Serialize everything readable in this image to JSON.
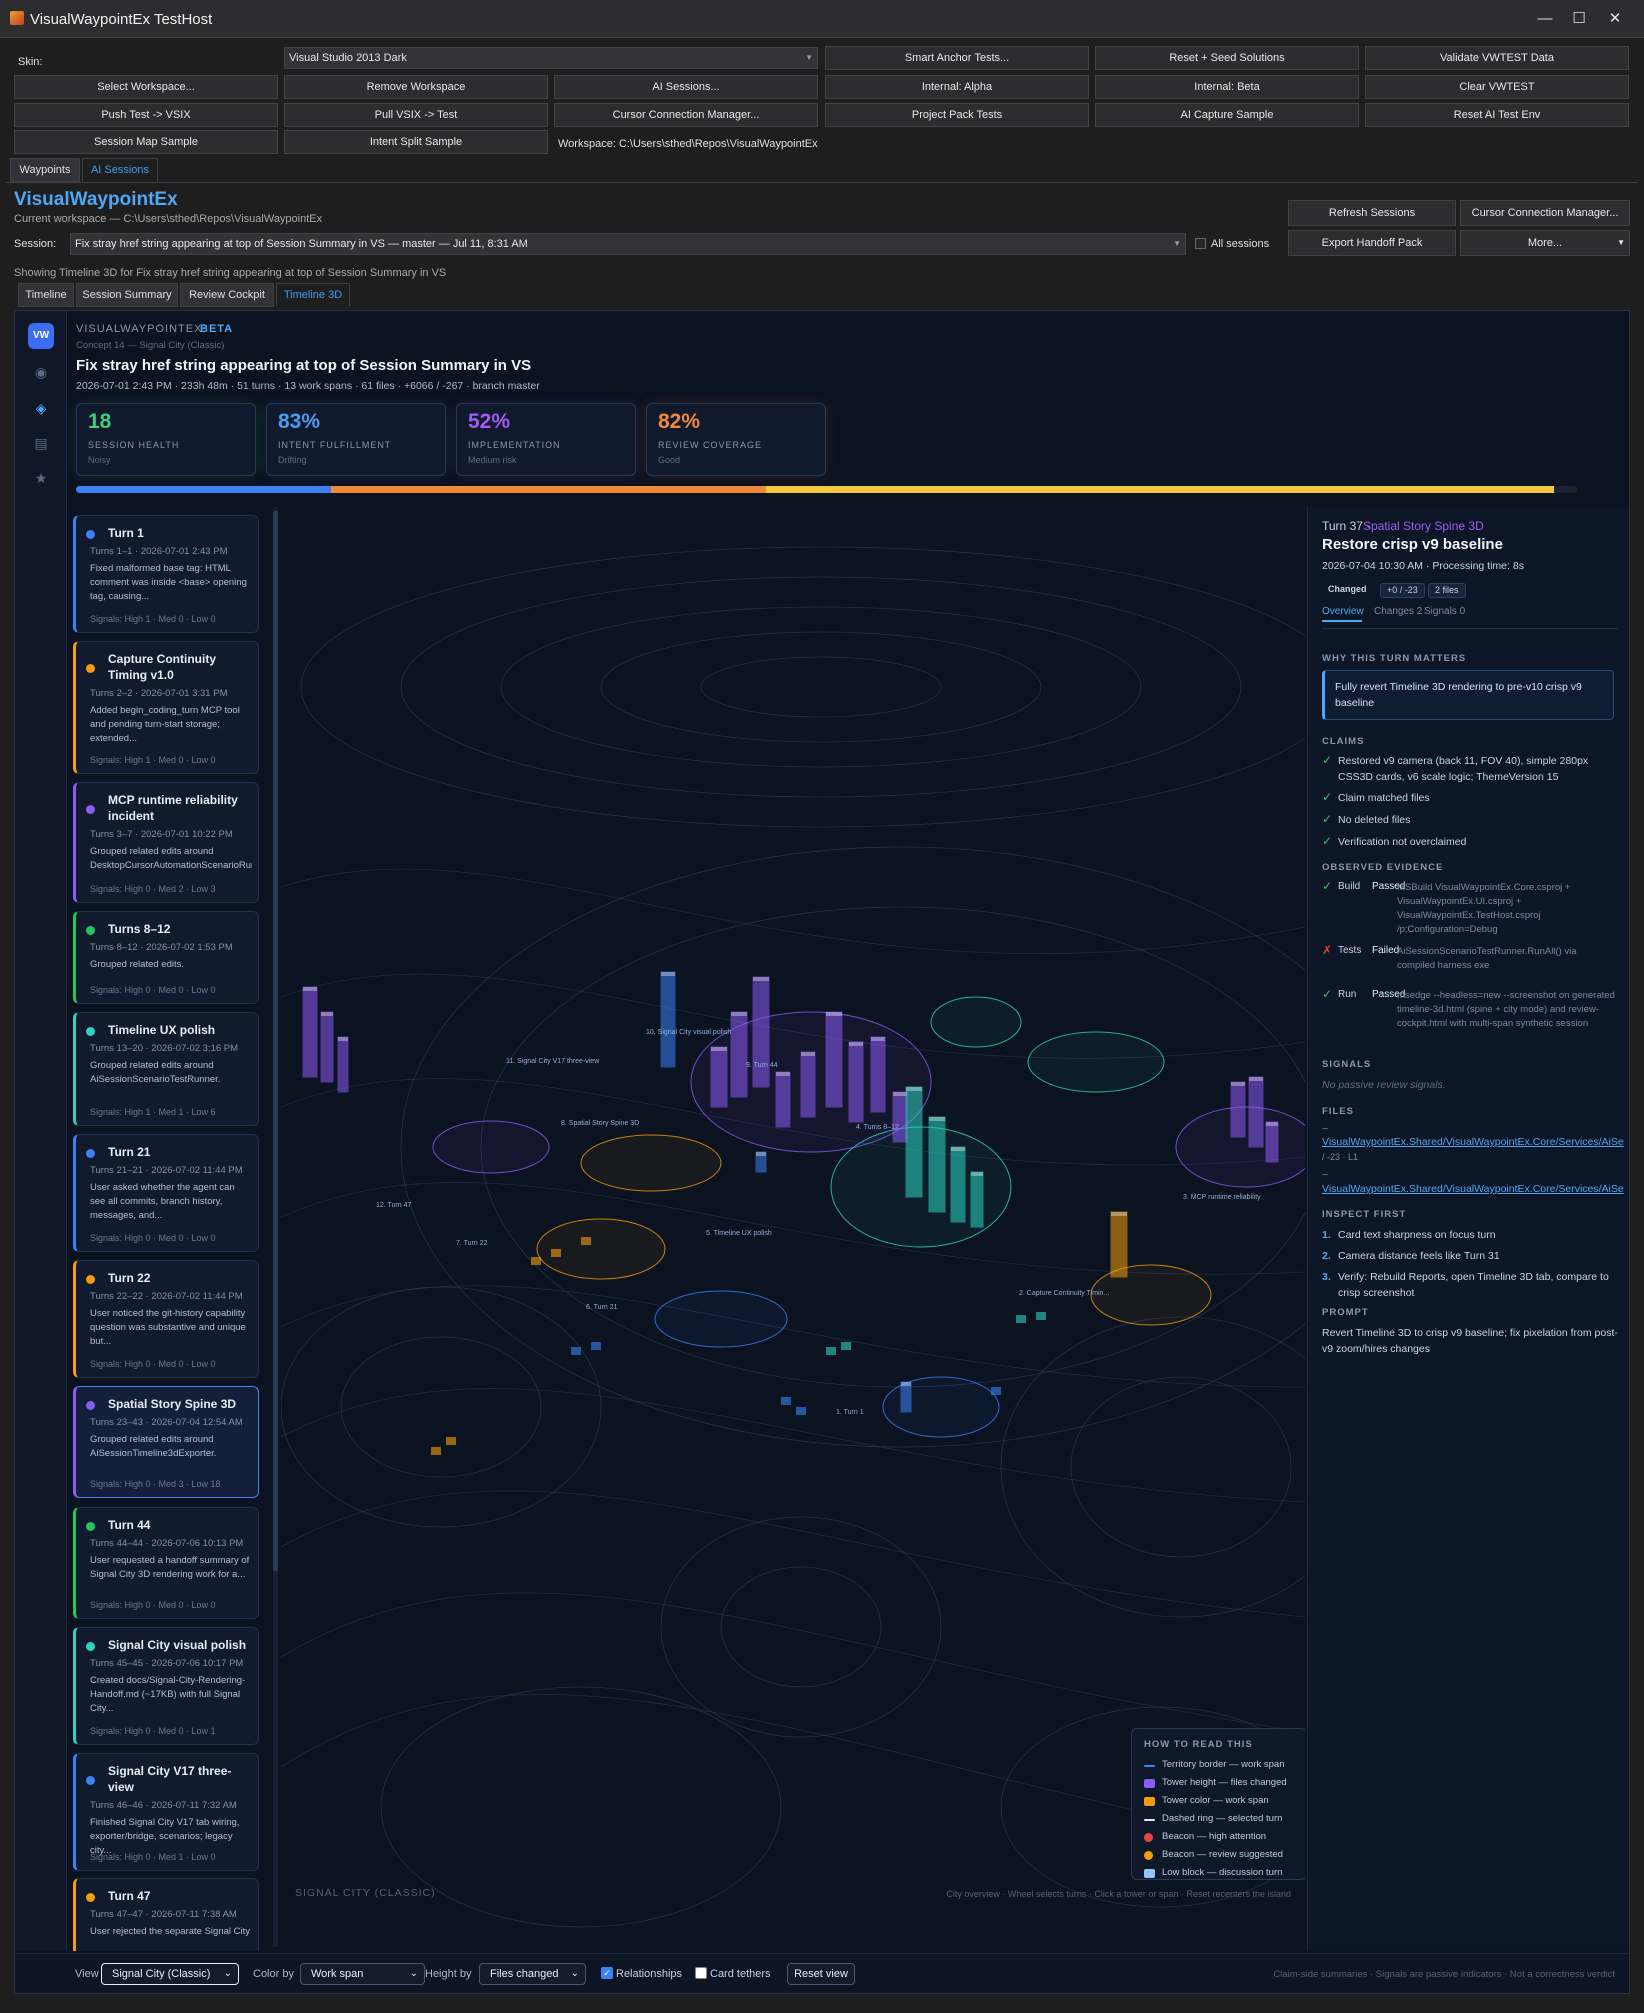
{
  "window": {
    "title": "VisualWaypointEx TestHost",
    "minimize": "—",
    "maximize": "☐",
    "close": "✕"
  },
  "toolbar": {
    "skin_label": "Skin:",
    "skin_value": "Visual Studio 2013 Dark",
    "buttons": [
      "Smart Anchor Tests...",
      "Reset + Seed Solutions",
      "Validate VWTEST Data",
      "Select Workspace...",
      "Remove Workspace",
      "AI Sessions...",
      "Internal: Alpha",
      "Internal: Beta",
      "Clear VWTEST",
      "Push Test -> VSIX",
      "Pull VSIX -> Test",
      "Cursor Connection Manager...",
      "Project Pack Tests",
      "AI Capture Sample",
      "Reset AI Test Env",
      "Session Map Sample",
      "Intent Split Sample"
    ],
    "workspace": "Workspace: C:\\Users\\sthed\\Repos\\VisualWaypointEx"
  },
  "main_tabs": [
    "Waypoints",
    "AI Sessions"
  ],
  "header": {
    "app_name": "VisualWaypointEx",
    "current_workspace": "Current workspace — C:\\Users\\sthed\\Repos\\VisualWaypointEx",
    "session_label": "Session:",
    "session_value": "Fix stray href string appearing at top of Session Summary in VS — master — Jul 11, 8:31 AM",
    "all_sessions": "All sessions",
    "buttons": [
      "Refresh Sessions",
      "Cursor Connection Manager...",
      "Export Handoff Pack",
      "More..."
    ],
    "showing": "Showing Timeline 3D for Fix stray href string appearing at top of Session Summary in VS"
  },
  "view_tabs": [
    "Timeline",
    "Session Summary",
    "Review Cockpit",
    "Timeline 3D"
  ],
  "web": {
    "brand": "VISUALWAYPOINTEX",
    "beta": "BETA",
    "concept": "Concept 14 — Signal City (Classic)",
    "logo": "VW",
    "title": "Fix stray href string appearing at top of Session Summary in VS",
    "meta": "2026-07-01 2:43 PM · 233h 48m · 51 turns · 13 work spans · 61 files · +6066 / -267 · branch master",
    "metrics": [
      {
        "value": "18",
        "caption": "SESSION HEALTH",
        "sub": "Noisy",
        "color": "#3fcf7a"
      },
      {
        "value": "83%",
        "caption": "INTENT FULFILLMENT",
        "sub": "Drifting",
        "color": "#4a9cf0"
      },
      {
        "value": "52%",
        "caption": "IMPLEMENTATION",
        "sub": "Medium risk",
        "color": "#a25cf2"
      },
      {
        "value": "82%",
        "caption": "REVIEW COVERAGE",
        "sub": "Good",
        "color": "#f08a3a"
      }
    ],
    "progress_segments": [
      0.17,
      0.29,
      0.53
    ]
  },
  "turns": [
    {
      "title": "Turn 1",
      "meta": "Turns 1–1 · 2026-07-01 2:43 PM",
      "desc": "Fixed malformed base tag: HTML comment was inside <base> opening tag, causing...",
      "signals": "Signals: High 1 · Med 0 · Low 0",
      "color": "#3b82f6"
    },
    {
      "title": "Capture Continuity Timing v1.0",
      "meta": "Turns 2–2 · 2026-07-01 3:31 PM",
      "desc": "Added begin_coding_turn MCP tool and pending turn-start storage; extended...",
      "signals": "Signals: High 1 · Med 0 · Low 0",
      "color": "#f59e0b"
    },
    {
      "title": "MCP runtime reliability incident",
      "meta": "Turns 3–7 · 2026-07-01 10:22 PM",
      "desc": "Grouped related edits around DesktopCursorAutomationScenarioRunne",
      "signals": "Signals: High 0 · Med 2 · Low 3",
      "color": "#8b5cf6"
    },
    {
      "title": "Turns 8–12",
      "meta": "Turns 8–12 · 2026-07-02 1:53 PM",
      "desc": "Grouped related edits.",
      "signals": "Signals: High 0 · Med 0 · Low 0",
      "color": "#22c55e"
    },
    {
      "title": "Timeline UX polish",
      "meta": "Turns 13–20 · 2026-07-02 3:16 PM",
      "desc": "Grouped related edits around AiSessionScenarioTestRunner.",
      "signals": "Signals: High 1 · Med 1 · Low 6",
      "color": "#2dd4bf"
    },
    {
      "title": "Turn 21",
      "meta": "Turns 21–21 · 2026-07-02 11:44 PM",
      "desc": "User asked whether the agent can see all commits, branch history, messages, and...",
      "signals": "Signals: High 0 · Med 0 · Low 0",
      "color": "#3b82f6"
    },
    {
      "title": "Turn 22",
      "meta": "Turns 22–22 · 2026-07-02 11:44 PM",
      "desc": "User noticed the git-history capability question was substantive and unique but...",
      "signals": "Signals: High 0 · Med 0 · Low 0",
      "color": "#f59e0b"
    },
    {
      "title": "Spatial Story Spine 3D",
      "meta": "Turns 23–43 · 2026-07-04 12:54 AM",
      "desc": "Grouped related edits around AiSessionTimeline3dExporter.",
      "signals": "Signals: High 0 · Med 3 · Low 18",
      "color": "#8b5cf6"
    },
    {
      "title": "Turn 44",
      "meta": "Turns 44–44 · 2026-07-06 10:13 PM",
      "desc": "User requested a handoff summary of Signal City 3D rendering work for a...",
      "signals": "Signals: High 0 · Med 0 · Low 0",
      "color": "#22c55e"
    },
    {
      "title": "Signal City visual polish",
      "meta": "Turns 45–45 · 2026-07-06 10:17 PM",
      "desc": "Created docs/Signal-City-Rendering-Handoff.md (~17KB) with full Signal City...",
      "signals": "Signals: High 0 · Med 0 · Low 1",
      "color": "#2dd4bf"
    },
    {
      "title": "Signal City V17 three-view",
      "meta": "Turns 46–46 · 2026-07-11 7:32 AM",
      "desc": "Finished Signal City V17 tab wiring, exporter/bridge, scenarios; legacy city...",
      "signals": "Signals: High 0 · Med 1 · Low 0",
      "color": "#3b82f6"
    },
    {
      "title": "Turn 47",
      "meta": "Turns 47–47 · 2026-07-11 7:38 AM",
      "desc": "User rejected the separate Signal City tab. Correct integration is:",
      "signals": "",
      "color": "#f59e0b"
    }
  ],
  "map": {
    "labels": [
      "10. Signal City visual polish",
      "11. Signal City V17 three-view",
      "8. Spatial Story Spine 3D",
      "9. Turn 44",
      "4. Turns 8–12",
      "12. Turn 47",
      "7. Turn 22",
      "5. Timeline UX polish",
      "3. MCP runtime reliability",
      "6. Turn 21",
      "2. Capture Continuity Timin...",
      "1. Turn 1"
    ],
    "city_name": "SIGNAL CITY (CLASSIC)",
    "hint": "City overview · Wheel selects turns · Click a tower or span · Reset recenters the island",
    "legend_title": "HOW TO READ THIS",
    "legend": [
      {
        "text": "Territory border — work span",
        "color": "#3b82f6"
      },
      {
        "text": "Tower height — files changed",
        "color": "#8b5cf6"
      },
      {
        "text": "Tower color — work span",
        "color": "#f59e0b"
      },
      {
        "text": "Dashed ring — selected turn",
        "color": "#e5e7eb"
      },
      {
        "text": "Beacon — high attention",
        "color": "#ef4444"
      },
      {
        "text": "Beacon — review suggested",
        "color": "#f59e0b"
      },
      {
        "text": "Low block — discussion turn",
        "color": "#93c5fd"
      }
    ]
  },
  "detail": {
    "turn_no": "Turn 37 ·",
    "span": "Spatial Story Spine 3D",
    "title": "Restore crisp v9 baseline",
    "time": "2026-07-04 10:30 AM · Processing time: 8s",
    "chips": [
      "Changed",
      "+0 / -23",
      "2 files"
    ],
    "tabs": [
      "Overview",
      "Changes 2",
      "Signals 0"
    ],
    "why_heading": "WHY THIS TURN MATTERS",
    "why": "Fully revert Timeline 3D rendering to pre-v10 crisp v9 baseline",
    "claims_heading": "CLAIMS",
    "claims": [
      "Restored v9 camera (back 11, FOV 40), simple 280px CSS3D cards, v6 scale logic; ThemeVersion 15",
      "Claim matched files",
      "No deleted files",
      "Verification not overclaimed"
    ],
    "evidence_heading": "OBSERVED EVIDENCE",
    "evidence": [
      {
        "kind": "Build",
        "status": "Passed",
        "text": "MSBuild VisualWaypointEx.Core.csproj + VisualWaypointEx.UI.csproj + VisualWaypointEx.TestHost.csproj /p:Configuration=Debug",
        "ok": true
      },
      {
        "kind": "Tests",
        "status": "Failed",
        "text": "AiSessionScenarioTestRunner.RunAll() via compiled harness exe",
        "ok": false
      },
      {
        "kind": "Run",
        "status": "Passed",
        "text": "msedge --headless=new --screenshot on generated timeline-3d.html (spine + city mode) and review-cockpit.html with multi-span synthetic session",
        "ok": true
      }
    ],
    "signals_heading": "SIGNALS",
    "signals": "No passive review signals.",
    "files_heading": "FILES",
    "files": [
      "VisualWaypointEx.Shared/VisualWaypointEx.Core/Services/AiSe",
      "VisualWaypointEx.Shared/VisualWaypointEx.Core/Services/AiSe"
    ],
    "file_delta": "/ -23 · L1",
    "inspect_heading": "INSPECT FIRST",
    "inspect": [
      "Card text sharpness on focus turn",
      "Camera distance feels like Turn 31",
      "Verify: Rebuild Reports, open Timeline 3D tab, compare to crisp screenshot"
    ],
    "prompt_heading": "PROMPT",
    "prompt": "Revert Timeline 3D to crisp v9 baseline; fix pixelation from post-v9 zoom/hires changes"
  },
  "bottom": {
    "view_label": "View",
    "view_value": "Signal City (Classic)",
    "color_label": "Color by",
    "color_value": "Work span",
    "height_label": "Height by",
    "height_value": "Files changed",
    "relationships": "Relationships",
    "tethers": "Card tethers",
    "reset": "Reset view",
    "footnote": "Claim-side summaries · Signals are passive indicators · Not a correctness verdict"
  }
}
